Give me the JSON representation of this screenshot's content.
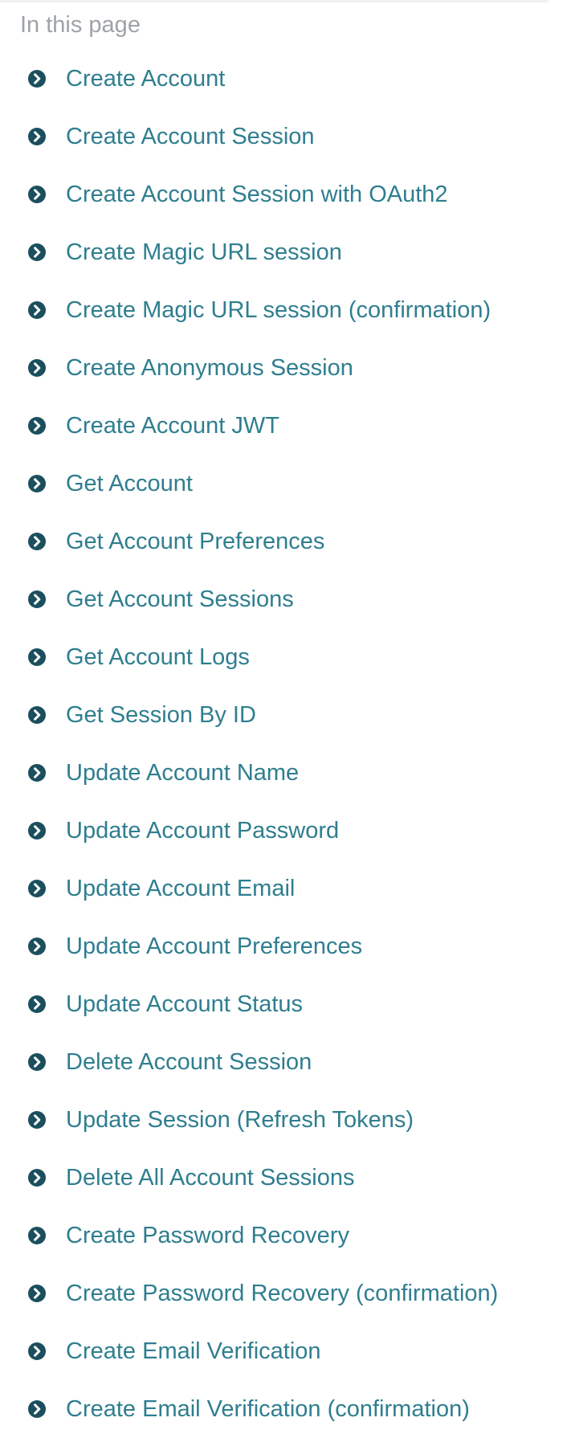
{
  "toc": {
    "heading": "In this page",
    "items": [
      {
        "label": "Create Account"
      },
      {
        "label": "Create Account Session"
      },
      {
        "label": "Create Account Session with OAuth2"
      },
      {
        "label": "Create Magic URL session"
      },
      {
        "label": "Create Magic URL session (confirmation)"
      },
      {
        "label": "Create Anonymous Session"
      },
      {
        "label": "Create Account JWT"
      },
      {
        "label": "Get Account"
      },
      {
        "label": "Get Account Preferences"
      },
      {
        "label": "Get Account Sessions"
      },
      {
        "label": "Get Account Logs"
      },
      {
        "label": "Get Session By ID"
      },
      {
        "label": "Update Account Name"
      },
      {
        "label": "Update Account Password"
      },
      {
        "label": "Update Account Email"
      },
      {
        "label": "Update Account Preferences"
      },
      {
        "label": "Update Account Status"
      },
      {
        "label": "Delete Account Session"
      },
      {
        "label": "Update Session (Refresh Tokens)"
      },
      {
        "label": "Delete All Account Sessions"
      },
      {
        "label": "Create Password Recovery"
      },
      {
        "label": "Create Password Recovery (confirmation)"
      },
      {
        "label": "Create Email Verification"
      },
      {
        "label": "Create Email Verification (confirmation)"
      }
    ],
    "icon": "chevron-circle-right-icon"
  },
  "colors": {
    "link": "#2f7e8f",
    "icon": "#1b4f5e",
    "heading": "#9ea3a8"
  }
}
